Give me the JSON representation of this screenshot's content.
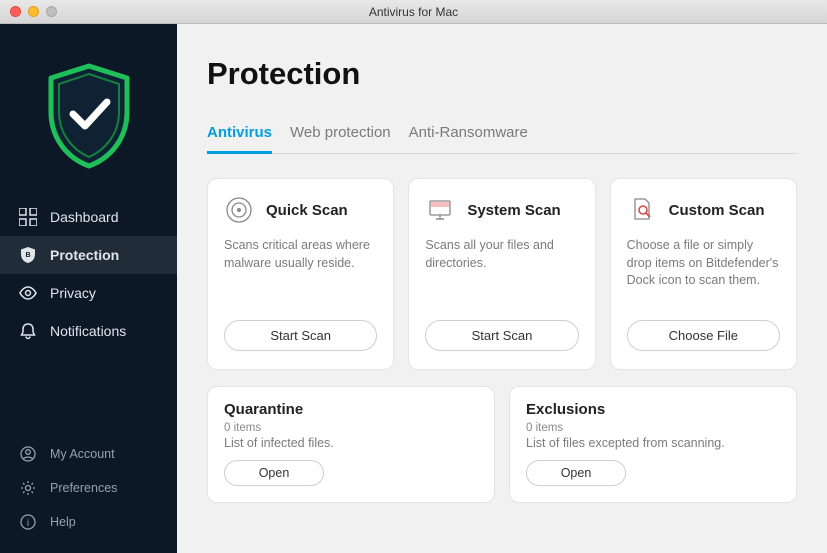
{
  "window": {
    "title": "Antivirus for Mac"
  },
  "sidebar": {
    "items": [
      {
        "label": "Dashboard"
      },
      {
        "label": "Protection"
      },
      {
        "label": "Privacy"
      },
      {
        "label": "Notifications"
      }
    ],
    "bottom": [
      {
        "label": "My Account"
      },
      {
        "label": "Preferences"
      },
      {
        "label": "Help"
      }
    ]
  },
  "page": {
    "title": "Protection"
  },
  "tabs": [
    {
      "label": "Antivirus",
      "active": true
    },
    {
      "label": "Web protection",
      "active": false
    },
    {
      "label": "Anti-Ransomware",
      "active": false
    }
  ],
  "scan_cards": [
    {
      "title": "Quick Scan",
      "desc": "Scans critical areas where malware usually reside.",
      "button": "Start Scan"
    },
    {
      "title": "System Scan",
      "desc": "Scans all your files and directories.",
      "button": "Start Scan"
    },
    {
      "title": "Custom Scan",
      "desc": "Choose a file or simply drop items on Bitdefender's Dock icon to scan them.",
      "button": "Choose File"
    }
  ],
  "info_cards": [
    {
      "title": "Quarantine",
      "sub": "0 items",
      "desc": "List of infected files.",
      "button": "Open"
    },
    {
      "title": "Exclusions",
      "sub": "0 items",
      "desc": "List of files excepted from scanning.",
      "button": "Open"
    }
  ],
  "colors": {
    "accent": "#00a0e0",
    "sidebar_bg": "#0c1826",
    "shield_green": "#1fbf5a"
  }
}
